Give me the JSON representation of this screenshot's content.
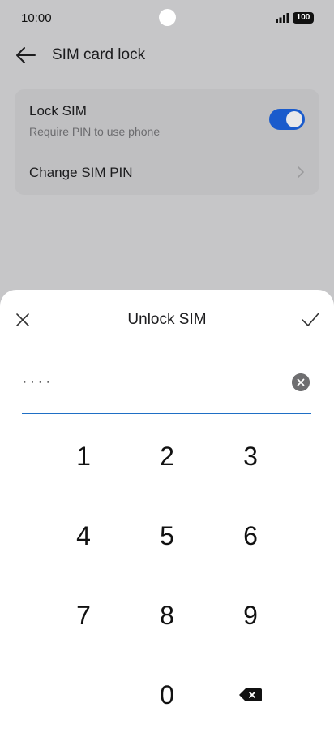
{
  "status_bar": {
    "time": "10:00",
    "battery": "100"
  },
  "app_bar": {
    "title": "SIM card lock"
  },
  "settings": {
    "lock_sim": {
      "title": "Lock SIM",
      "subtitle": "Require PIN to use phone",
      "enabled": true
    },
    "change_pin": {
      "title": "Change SIM PIN"
    }
  },
  "sheet": {
    "title": "Unlock SIM",
    "pin_value": "····"
  },
  "keypad": {
    "keys": [
      "1",
      "2",
      "3",
      "4",
      "5",
      "6",
      "7",
      "8",
      "9",
      "0"
    ]
  },
  "colors": {
    "accent": "#1a5bcc",
    "underline": "#1f6fc5"
  },
  "icons": {
    "back": "arrow-left-icon",
    "chevron": "chevron-right-icon",
    "close": "close-icon",
    "confirm": "check-icon",
    "clear": "clear-icon",
    "backspace": "backspace-icon"
  }
}
